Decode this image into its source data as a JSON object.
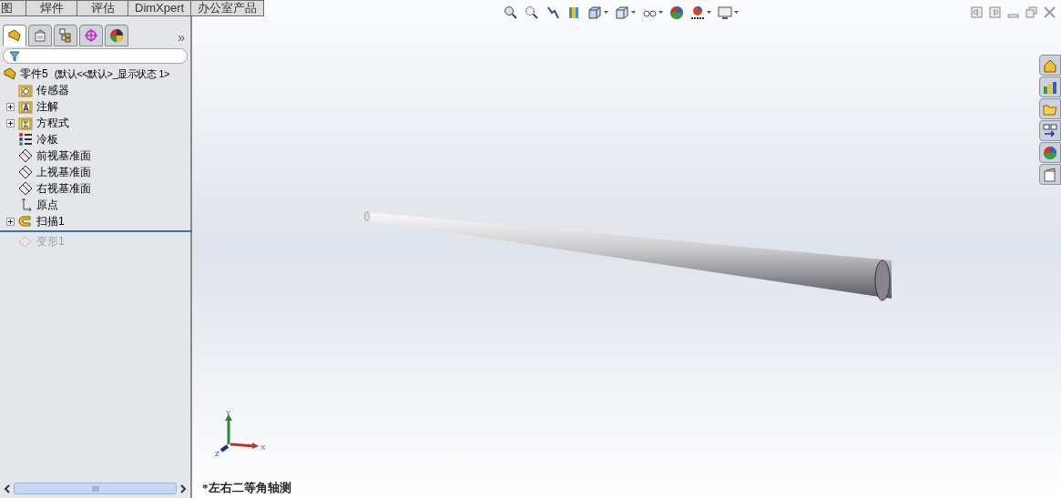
{
  "command_tabs": [
    {
      "label": "图",
      "selected": false
    },
    {
      "label": "焊件",
      "selected": false
    },
    {
      "label": "评估",
      "selected": false
    },
    {
      "label": "DimXpert",
      "selected": false
    },
    {
      "label": "办公室产品",
      "selected": false
    }
  ],
  "panel_tabs": [
    {
      "kind": "feature-tree",
      "selected": true
    },
    {
      "kind": "property",
      "selected": false
    },
    {
      "kind": "config",
      "selected": false
    },
    {
      "kind": "dimxpert",
      "selected": false
    },
    {
      "kind": "display",
      "selected": false
    }
  ],
  "panel_more": "»",
  "tree": {
    "name": "零件5",
    "config": "(默认<<默认>_显示状态 1>",
    "children": [
      {
        "kind": "sensor",
        "label": "传感器",
        "disabled": false
      },
      {
        "kind": "annotation",
        "label": "注解",
        "expanded": false,
        "disabled": false
      },
      {
        "kind": "equation",
        "label": "方程式",
        "expanded": false,
        "disabled": false
      },
      {
        "kind": "material",
        "label": "冷板",
        "disabled": false
      },
      {
        "kind": "plane",
        "label": "前视基准面",
        "disabled": false
      },
      {
        "kind": "plane",
        "label": "上视基准面",
        "disabled": false
      },
      {
        "kind": "plane",
        "label": "右视基准面",
        "disabled": false
      },
      {
        "kind": "origin",
        "label": "原点",
        "disabled": false
      },
      {
        "kind": "sweep",
        "label": "扫描1",
        "expanded": false,
        "disabled": false
      },
      {
        "kind": "rollback"
      },
      {
        "kind": "deform",
        "label": "变形1",
        "disabled": true
      }
    ]
  },
  "triad": {
    "x": "X",
    "y": "Y",
    "z": "Z"
  },
  "view_name": "*左右二等角轴测"
}
